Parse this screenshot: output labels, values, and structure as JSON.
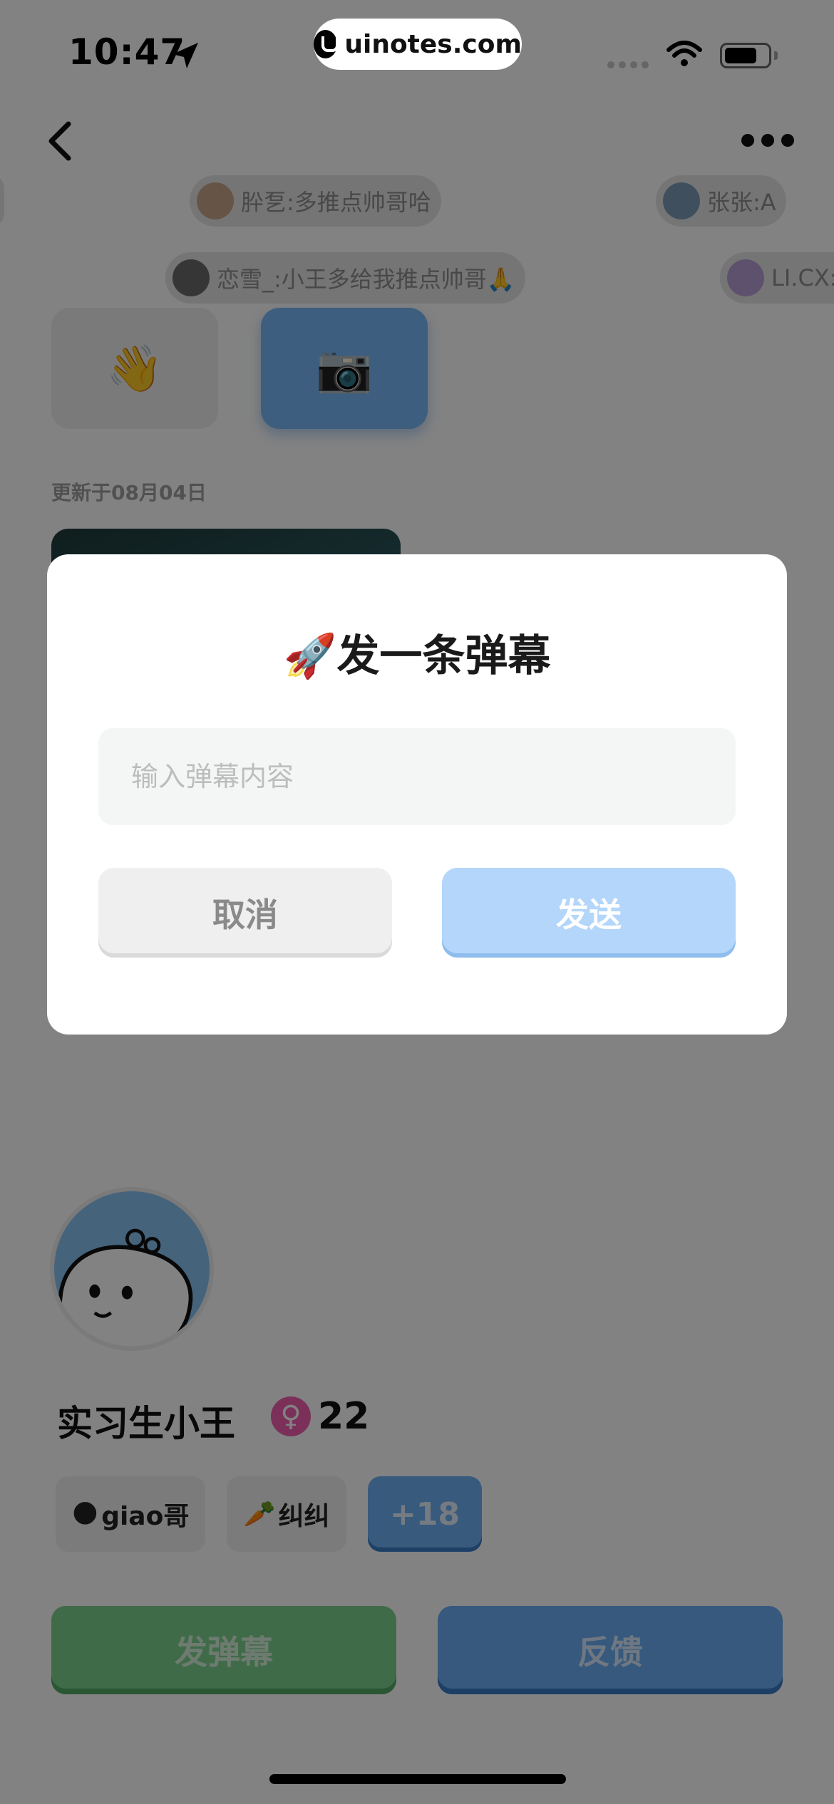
{
  "status_bar": {
    "time": "10:47",
    "watermark": "uinotes.com",
    "location_icon": "location-arrow-icon",
    "wifi_icon": "wifi-icon",
    "battery_icon": "battery-icon"
  },
  "nav": {
    "back_icon": "chevron-left-icon",
    "more_icon": "more-dots-icon"
  },
  "danmaku": [
    {
      "text": "肸乭:多推点帅哥哈"
    },
    {
      "text": "张张:A"
    },
    {
      "text": "恋雪_:小王多给我推点帅哥🙏"
    },
    {
      "text": "LI.CX:"
    }
  ],
  "actions": {
    "wave_emoji": "👋",
    "camera_emoji": "📷"
  },
  "updated_text": "更新于08月04日",
  "profile": {
    "name": "实习生小王",
    "gender_symbol": "♀",
    "age": "22",
    "tags": [
      {
        "emoji": "🌑",
        "label": "giao哥"
      },
      {
        "emoji": "🥕",
        "label": "纠纠"
      }
    ],
    "more_tags": "+18"
  },
  "bottom_buttons": {
    "danmaku_label": "发弹幕",
    "feedback_label": "反馈"
  },
  "modal": {
    "title": "🚀发一条弹幕",
    "input_placeholder": "输入弹幕内容",
    "input_value": "",
    "cancel_label": "取消",
    "send_label": "发送"
  },
  "colors": {
    "accent_blue": "#6aaef5",
    "accent_green": "#7fd28f",
    "send_disabled": "#b3d6fa",
    "gender_pink": "#f15fae"
  }
}
